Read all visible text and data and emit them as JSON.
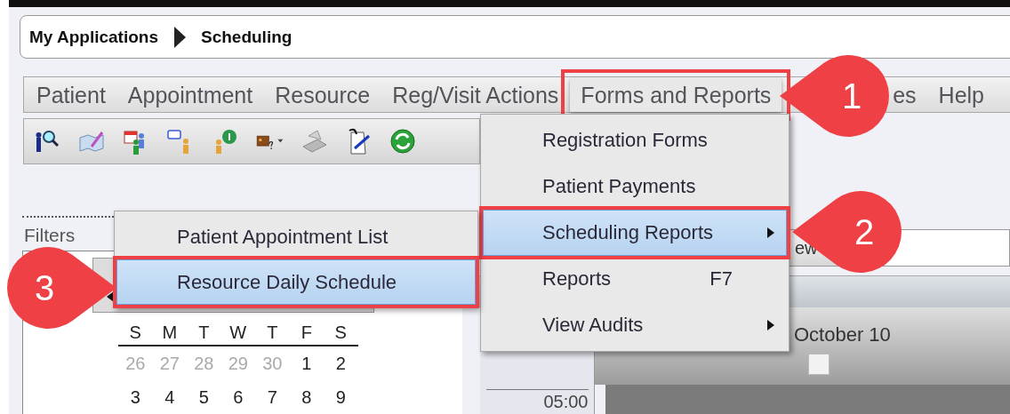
{
  "breadcrumb": [
    "My Applications",
    "Scheduling"
  ],
  "menubar": [
    {
      "label": "Patient",
      "selected": false,
      "highlighted": false
    },
    {
      "label": "Appointment",
      "selected": false,
      "highlighted": false
    },
    {
      "label": "Resource",
      "selected": false,
      "highlighted": false
    },
    {
      "label": "Reg/Visit Actions",
      "selected": false,
      "highlighted": false
    },
    {
      "label": "Forms and Reports",
      "selected": true,
      "highlighted": true
    },
    {
      "label": "es",
      "selected": false,
      "highlighted": false
    },
    {
      "label": "Help",
      "selected": false,
      "highlighted": false
    }
  ],
  "menu": {
    "items": [
      {
        "label": "Registration Forms",
        "submenu": false,
        "selected": false,
        "highlighted": false
      },
      {
        "label": "Patient Payments",
        "submenu": false,
        "selected": false,
        "highlighted": false
      },
      {
        "label": "Scheduling Reports",
        "submenu": true,
        "selected": true,
        "highlighted": true
      },
      {
        "label": "Reports",
        "shortcut": "F7",
        "submenu": false,
        "selected": false,
        "highlighted": false
      },
      {
        "label": "View Audits",
        "submenu": true,
        "selected": false,
        "highlighted": false
      }
    ]
  },
  "submenu": {
    "items": [
      {
        "label": "Patient Appointment List",
        "selected": false,
        "highlighted": false
      },
      {
        "label": "Resource Daily Schedule",
        "selected": true,
        "highlighted": true
      }
    ]
  },
  "filters": {
    "title": "Filters",
    "calendar": {
      "weekdays": [
        "S",
        "M",
        "T",
        "W",
        "T",
        "F",
        "S"
      ],
      "weeks": [
        [
          {
            "day": "26",
            "other_month": true
          },
          {
            "day": "27",
            "other_month": true
          },
          {
            "day": "28",
            "other_month": true
          },
          {
            "day": "29",
            "other_month": true
          },
          {
            "day": "30",
            "other_month": true
          },
          {
            "day": "1",
            "other_month": false
          },
          {
            "day": "2",
            "other_month": false
          }
        ],
        [
          {
            "day": "3",
            "other_month": false
          },
          {
            "day": "4",
            "other_month": false
          },
          {
            "day": "5",
            "other_month": false
          },
          {
            "day": "6",
            "other_month": false
          },
          {
            "day": "7",
            "other_month": false
          },
          {
            "day": "8",
            "other_month": false
          },
          {
            "day": "9",
            "other_month": false
          }
        ]
      ]
    }
  },
  "schedule": {
    "view_button": "ew",
    "column": "October 10",
    "column_checked": false,
    "times": [
      "05:00"
    ]
  },
  "callouts": [
    {
      "number": "1",
      "kind": "left"
    },
    {
      "number": "2",
      "kind": "left"
    },
    {
      "number": "3",
      "kind": "right"
    }
  ]
}
